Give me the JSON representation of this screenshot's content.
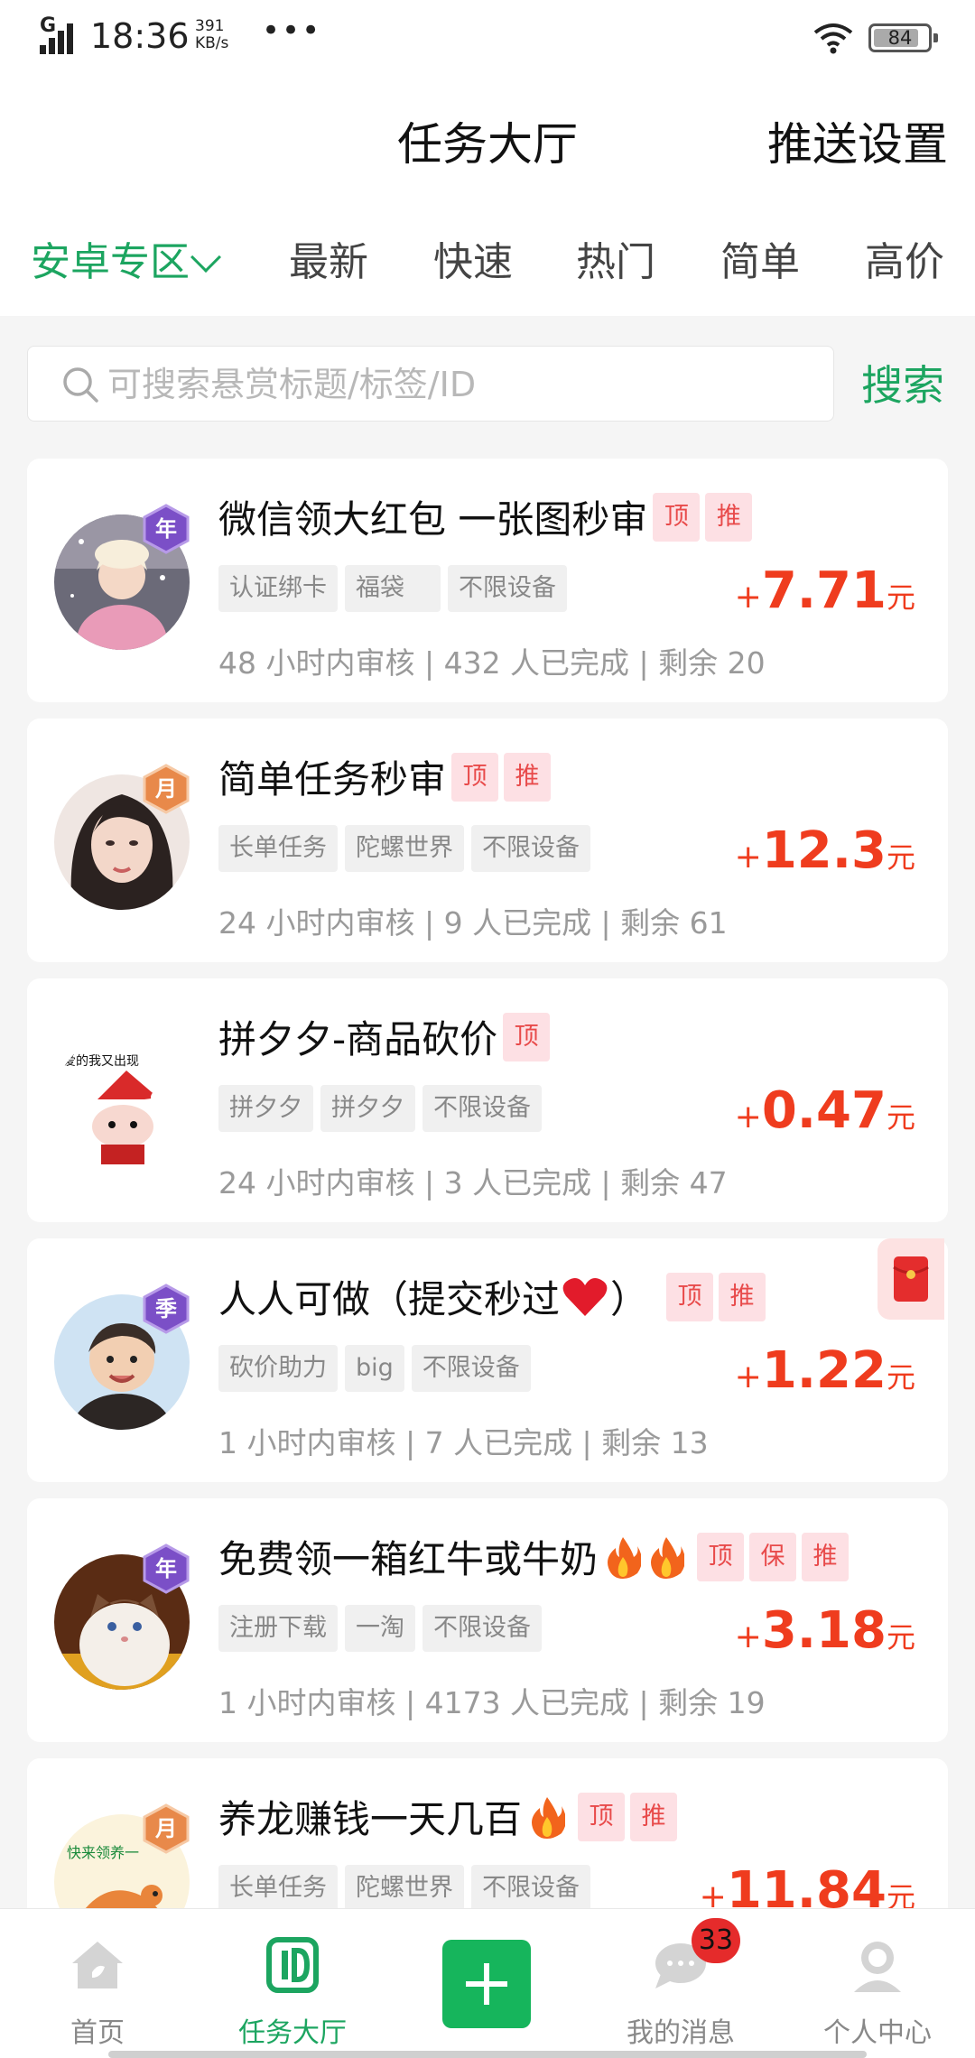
{
  "status_bar": {
    "signal_label": "G",
    "time": "18:36",
    "net_speed_value": "391",
    "net_speed_unit": "KB/s",
    "dots": "•••",
    "battery": "84",
    "battery_level": 0.84
  },
  "header": {
    "title": "任务大厅",
    "push_settings": "推送设置"
  },
  "tabs": [
    {
      "label": "安卓专区",
      "active": true
    },
    {
      "label": "最新"
    },
    {
      "label": "快速"
    },
    {
      "label": "热门"
    },
    {
      "label": "简单"
    },
    {
      "label": "高价"
    }
  ],
  "search": {
    "placeholder": "可搜索悬赏标题/标签/ID",
    "button": "搜索"
  },
  "tasks": [
    {
      "title": "微信领大红包 一张图秒审",
      "badge": "年",
      "flags": [
        "顶",
        "推"
      ],
      "tags": [
        "认证绑卡",
        "福袋",
        "不限设备"
      ],
      "price_sign": "+",
      "price": "7.71",
      "unit": "元",
      "meta": "48 小时内审核 | 432 人已完成 | 剩余 20"
    },
    {
      "title": "简单任务秒审",
      "badge": "月",
      "flags": [
        "顶",
        "推"
      ],
      "tags": [
        "长单任务",
        "陀螺世界",
        "不限设备"
      ],
      "price_sign": "+",
      "price": "12.3",
      "unit": "元",
      "meta": "24 小时内审核 | 9 人已完成 | 剩余 61"
    },
    {
      "title": "拼夕夕-商品砍价",
      "badge": "",
      "avatar_caption": "爱的我又出现",
      "flags": [
        "顶"
      ],
      "tags": [
        "拼夕夕",
        "拼夕夕",
        "不限设备"
      ],
      "price_sign": "+",
      "price": "0.47",
      "unit": "元",
      "meta": "24 小时内审核 | 3 人已完成 | 剩余 47"
    },
    {
      "title_pre": "人人可做（提交秒过",
      "title_post": "）",
      "badge": "季",
      "flags": [
        "顶",
        "推"
      ],
      "tags": [
        "砍价助力",
        "big",
        "不限设备"
      ],
      "price_sign": "+",
      "price": "1.22",
      "unit": "元",
      "meta": "1 小时内审核 | 7 人已完成 | 剩余 13"
    },
    {
      "title": "免费领一箱红牛或牛奶",
      "badge": "年",
      "flags": [
        "顶",
        "保",
        "推"
      ],
      "tags": [
        "注册下载",
        "一淘",
        "不限设备"
      ],
      "price_sign": "+",
      "price": "3.18",
      "unit": "元",
      "meta": "1 小时内审核 | 4173 人已完成 | 剩余 19"
    },
    {
      "title": "养龙赚钱一天几百",
      "badge": "月",
      "avatar_caption": "快来领养一",
      "flags": [
        "顶",
        "推"
      ],
      "tags": [
        "长单任务",
        "陀螺世界",
        "不限设备"
      ],
      "price_sign": "+",
      "price": "11.84",
      "unit": "元",
      "meta": ""
    }
  ],
  "bottom_nav": {
    "home": "首页",
    "hall": "任务大厅",
    "messages": "我的消息",
    "message_count": "33",
    "profile": "个人中心"
  },
  "colors": {
    "brand_green": "#1ca560",
    "price_red": "#ef3c1e",
    "flag_bg": "#fde0e4",
    "flag_text": "#e84a4a",
    "badge_purple": "#7b4fc7",
    "badge_orange": "#e8894a"
  }
}
